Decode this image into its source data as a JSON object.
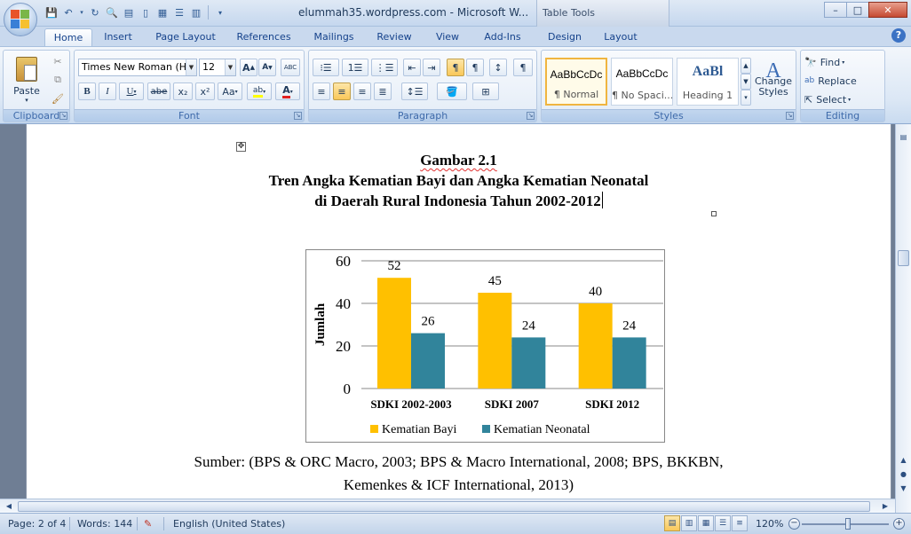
{
  "window": {
    "title": "elummah35.wordpress.com - Microsoft W...",
    "context_tab_group": "Table Tools",
    "minimize": "–",
    "maximize": "□",
    "close": "✕"
  },
  "tabs": [
    "Home",
    "Insert",
    "Page Layout",
    "References",
    "Mailings",
    "Review",
    "View",
    "Add-Ins",
    "Design",
    "Layout"
  ],
  "active_tab": "Home",
  "help": "?",
  "ribbon": {
    "clipboard": {
      "label": "Clipboard",
      "paste": "Paste"
    },
    "font": {
      "label": "Font",
      "font_name": "Times New Roman (Hea",
      "font_size": "12",
      "bold": "B",
      "italic": "I",
      "underline": "U",
      "strike": "abe",
      "subscript": "x₂",
      "superscript": "x²",
      "change_case": "Aa",
      "grow": "A",
      "shrink": "A",
      "clear": "ABC",
      "highlight": "ab",
      "font_color": "A"
    },
    "paragraph": {
      "label": "Paragraph",
      "show_marks": "¶"
    },
    "styles": {
      "label": "Styles",
      "items": [
        {
          "sample": "AaBbCcDc",
          "name": "¶ Normal"
        },
        {
          "sample": "AaBbCcDc",
          "name": "¶ No Spaci..."
        },
        {
          "sample": "AaBl",
          "name": "Heading 1"
        }
      ],
      "change_styles": "Change Styles"
    },
    "editing": {
      "label": "Editing",
      "find": "Find",
      "replace": "Replace",
      "select": "Select"
    }
  },
  "document": {
    "caption_line1": "Gambar 2.1",
    "caption_line2": "Tren Angka Kematian Bayi dan Angka Kematian Neonatal",
    "caption_line3": "di Daerah Rural Indonesia Tahun 2002-2012",
    "source_line1": "Sumber: (BPS & ORC Macro, 2003; BPS & Macro International, 2008; BPS, BKKBN,",
    "source_line2": "Kemenkes & ICF International, 2013)"
  },
  "chart_data": {
    "type": "bar",
    "categories": [
      "SDKI 2002-2003",
      "SDKI 2007",
      "SDKI 2012"
    ],
    "series": [
      {
        "name": "Kematian Bayi",
        "values": [
          52,
          45,
          40
        ],
        "color": "#ffc000"
      },
      {
        "name": "Kematian Neonatal",
        "values": [
          26,
          24,
          24
        ],
        "color": "#31849b"
      }
    ],
    "ylabel": "Jumlah",
    "ylim": [
      0,
      60
    ],
    "yticks": [
      0,
      20,
      40,
      60
    ],
    "grid": true,
    "legend": "bottom"
  },
  "status": {
    "page": "Page: 2 of 4",
    "words": "Words: 144",
    "language": "English (United States)",
    "zoom": "120%"
  }
}
